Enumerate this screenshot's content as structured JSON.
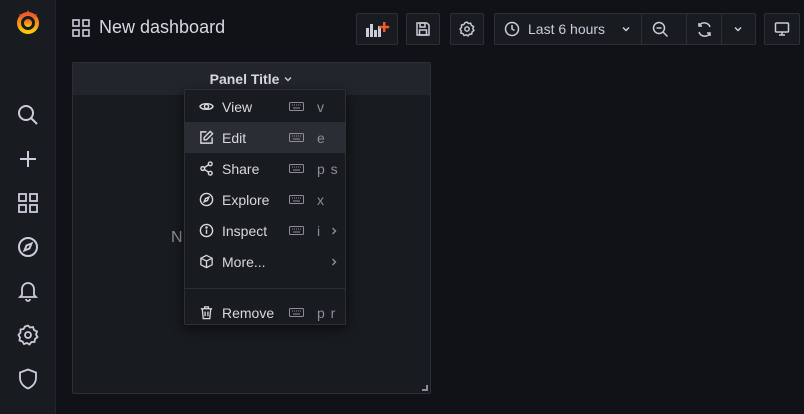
{
  "sidebar": {
    "items": [
      {
        "name": "grafana-logo"
      },
      {
        "name": "search-icon"
      },
      {
        "name": "plus-icon"
      },
      {
        "name": "dashboards-icon"
      },
      {
        "name": "explore-compass-icon"
      },
      {
        "name": "alerting-bell-icon"
      },
      {
        "name": "settings-gear-icon"
      },
      {
        "name": "server-admin-shield-icon"
      }
    ]
  },
  "header": {
    "title": "New dashboard",
    "time_range": "Last 6 hours",
    "buttons": [
      "add-panel",
      "save",
      "settings",
      "time-picker",
      "zoom-out",
      "refresh",
      "refresh-interval",
      "tv-mode"
    ]
  },
  "panel": {
    "title": "Panel Title",
    "no_data_partial": "N"
  },
  "menu": {
    "items": [
      {
        "label": "View",
        "shortcut": "v",
        "icon": "eye-icon"
      },
      {
        "label": "Edit",
        "shortcut": "e",
        "icon": "edit-icon",
        "active": true
      },
      {
        "label": "Share",
        "shortcut": "p s",
        "icon": "share-icon"
      },
      {
        "label": "Explore",
        "shortcut": "x",
        "icon": "compass-icon"
      },
      {
        "label": "Inspect",
        "shortcut": "i",
        "icon": "info-icon",
        "submenu": true
      },
      {
        "label": "More...",
        "shortcut": "",
        "icon": "cube-icon",
        "submenu": true
      },
      {
        "label": "Remove",
        "shortcut": "p r",
        "icon": "trash-icon"
      }
    ]
  },
  "colors": {
    "background": "#111217",
    "sidebar": "#181b1f",
    "border": "#2c3036",
    "accent_orange": "#f05a28",
    "text": "#d8d9e0",
    "muted": "#8e8e9a"
  }
}
